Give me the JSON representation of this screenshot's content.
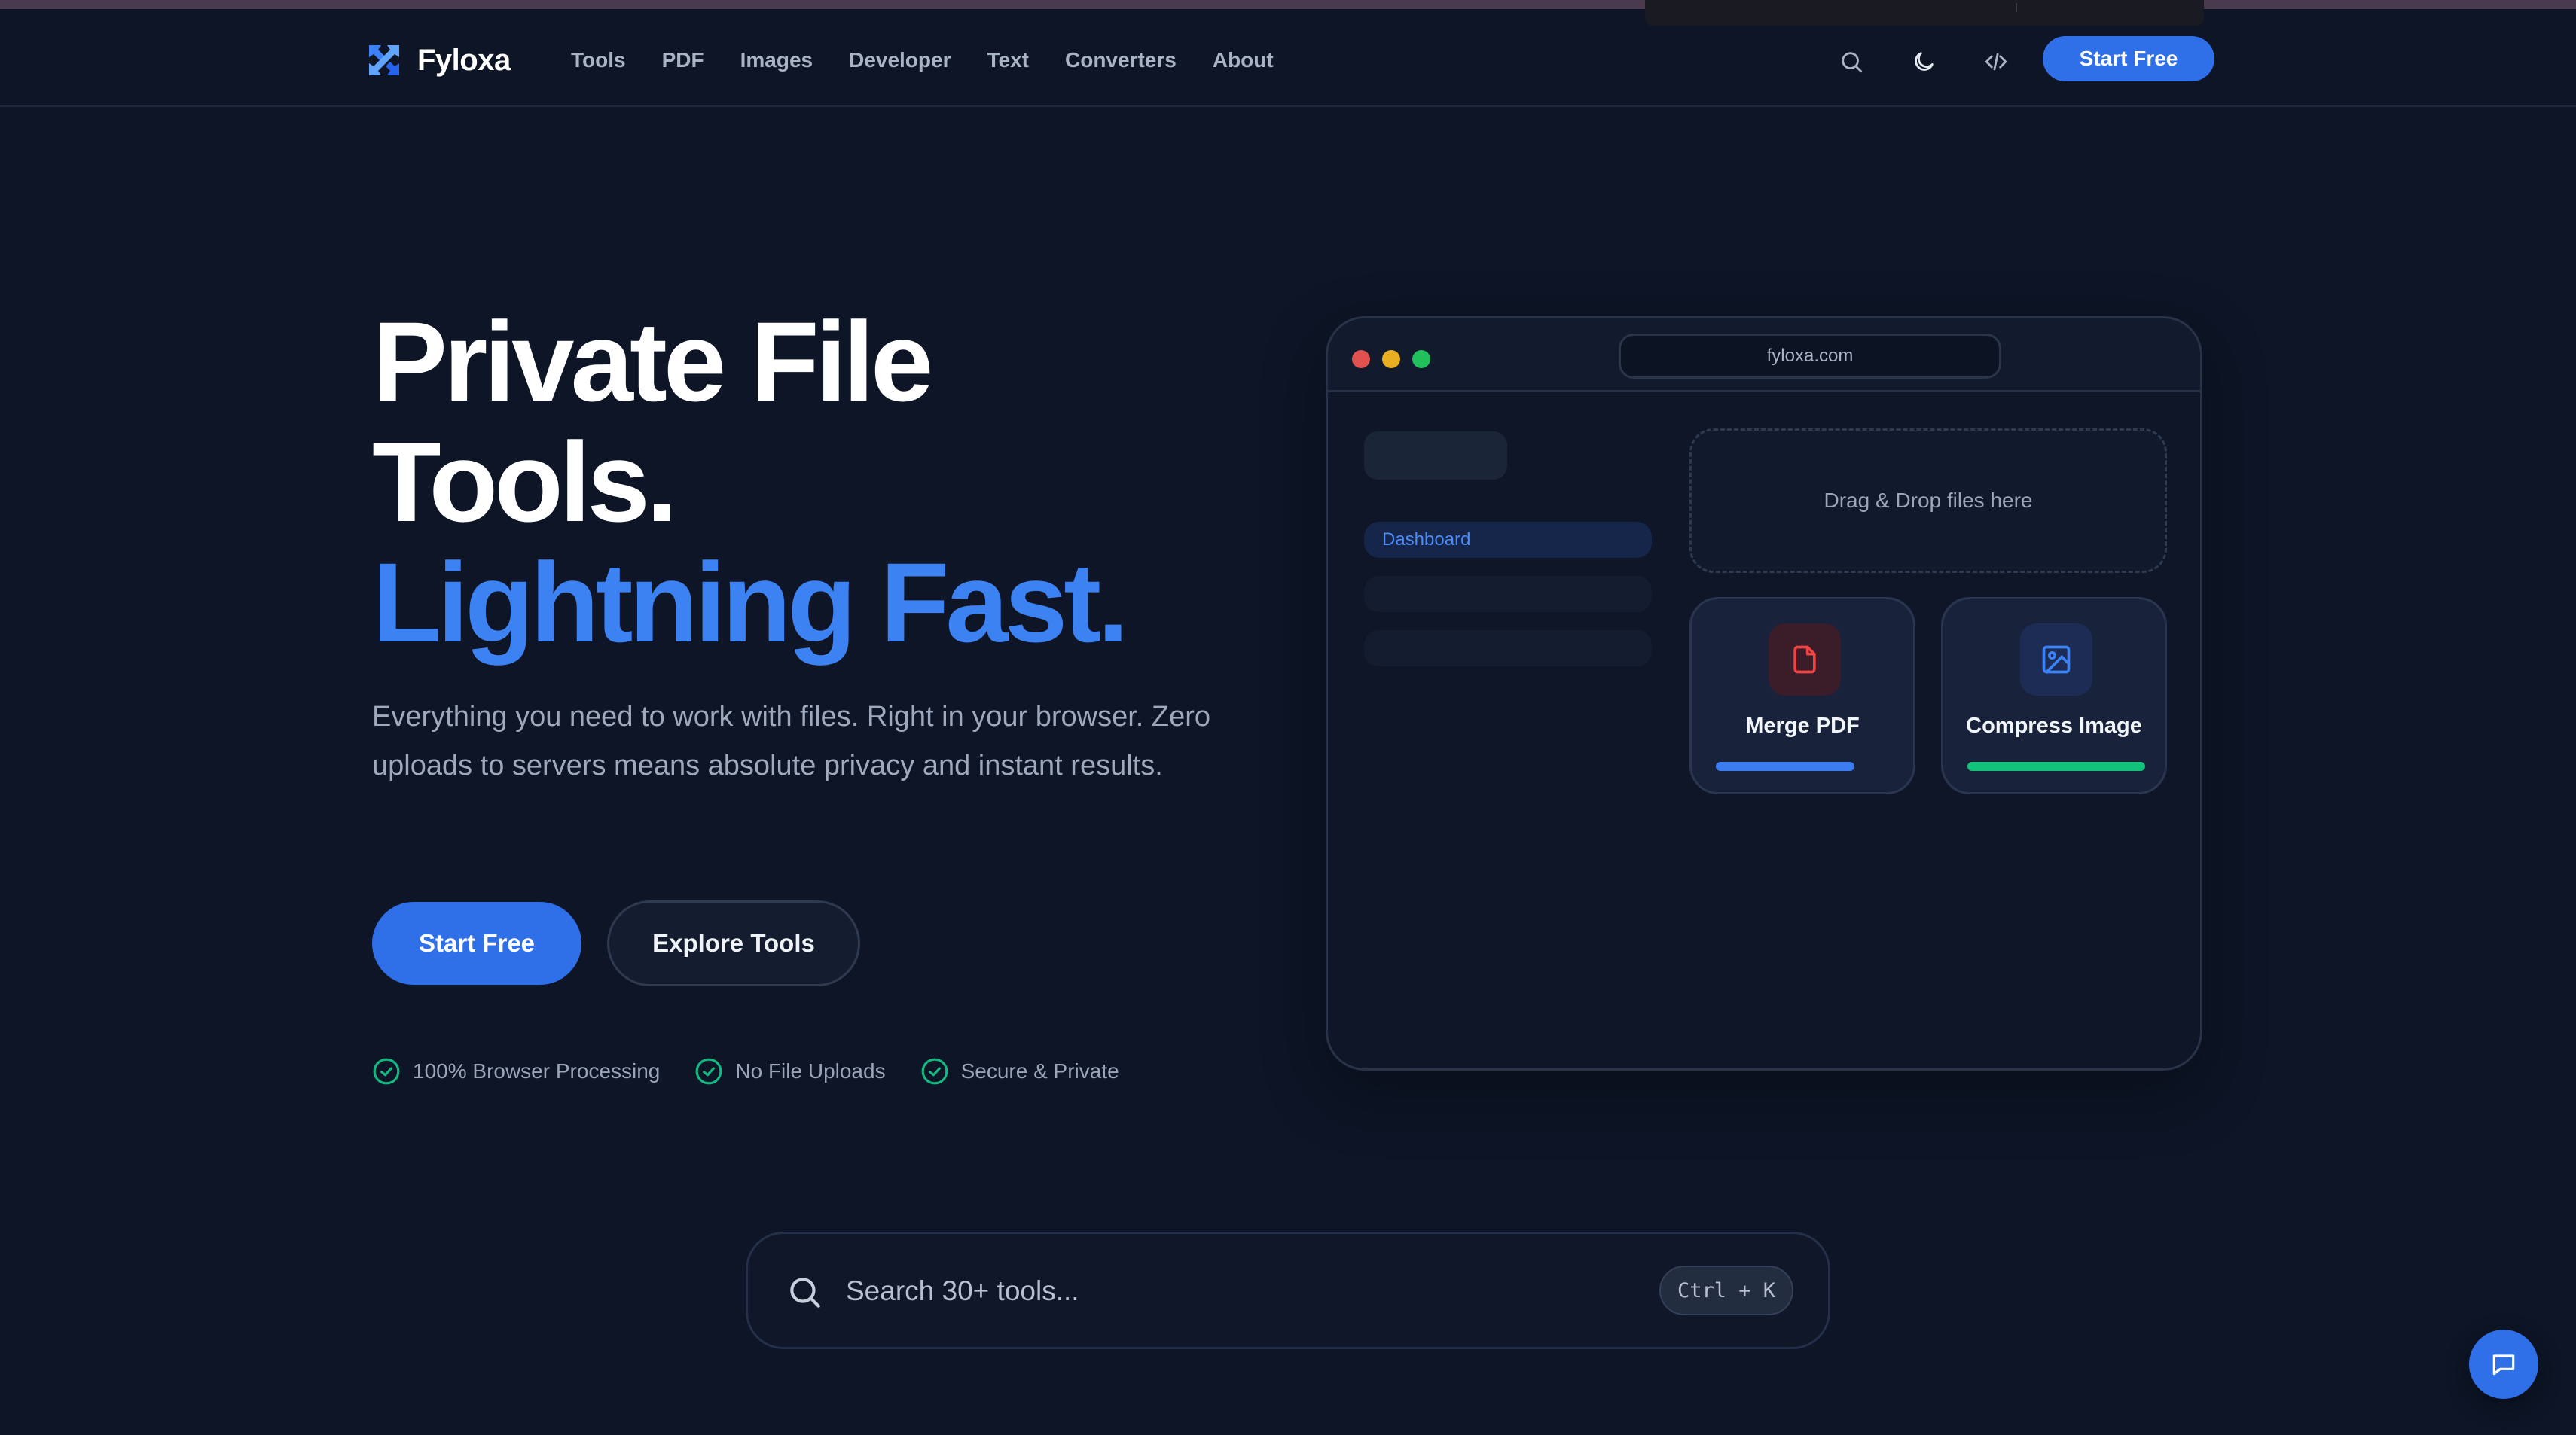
{
  "colors": {
    "background": "#0d1526",
    "accent": "#2f6fe8",
    "headline_accent": "#3d82f2",
    "success": "#12c27a",
    "danger": "#e0514f"
  },
  "header": {
    "brand": "Fyloxa",
    "brand_icon": "arrows-cross-icon",
    "nav": [
      "Tools",
      "PDF",
      "Images",
      "Developer",
      "Text",
      "Converters",
      "About"
    ],
    "icons": [
      "search-icon",
      "moon-icon",
      "code-icon"
    ],
    "cta": "Start Free"
  },
  "hero": {
    "title_line1": "Private File",
    "title_line2": "Tools.",
    "title_line3": "Lightning Fast.",
    "subtitle": "Everything you need to work with files. Right in your browser. Zero uploads to servers means absolute privacy and instant results.",
    "primary_button": "Start Free",
    "secondary_button": "Explore Tools",
    "badges": [
      "100% Browser Processing",
      "No File Uploads",
      "Secure & Private"
    ]
  },
  "mockup": {
    "url": "fyloxa.com",
    "sidebar_active": "Dashboard",
    "dropzone": "Drag & Drop files here",
    "cards": [
      {
        "label": "Merge PDF",
        "icon": "file-icon",
        "progress": 0.78
      },
      {
        "label": "Compress Image",
        "icon": "image-icon",
        "progress": 1.0
      }
    ]
  },
  "search": {
    "placeholder": "Search 30+ tools...",
    "shortcut": "Ctrl + K"
  },
  "chat": {
    "icon": "chat-bubble-icon"
  }
}
